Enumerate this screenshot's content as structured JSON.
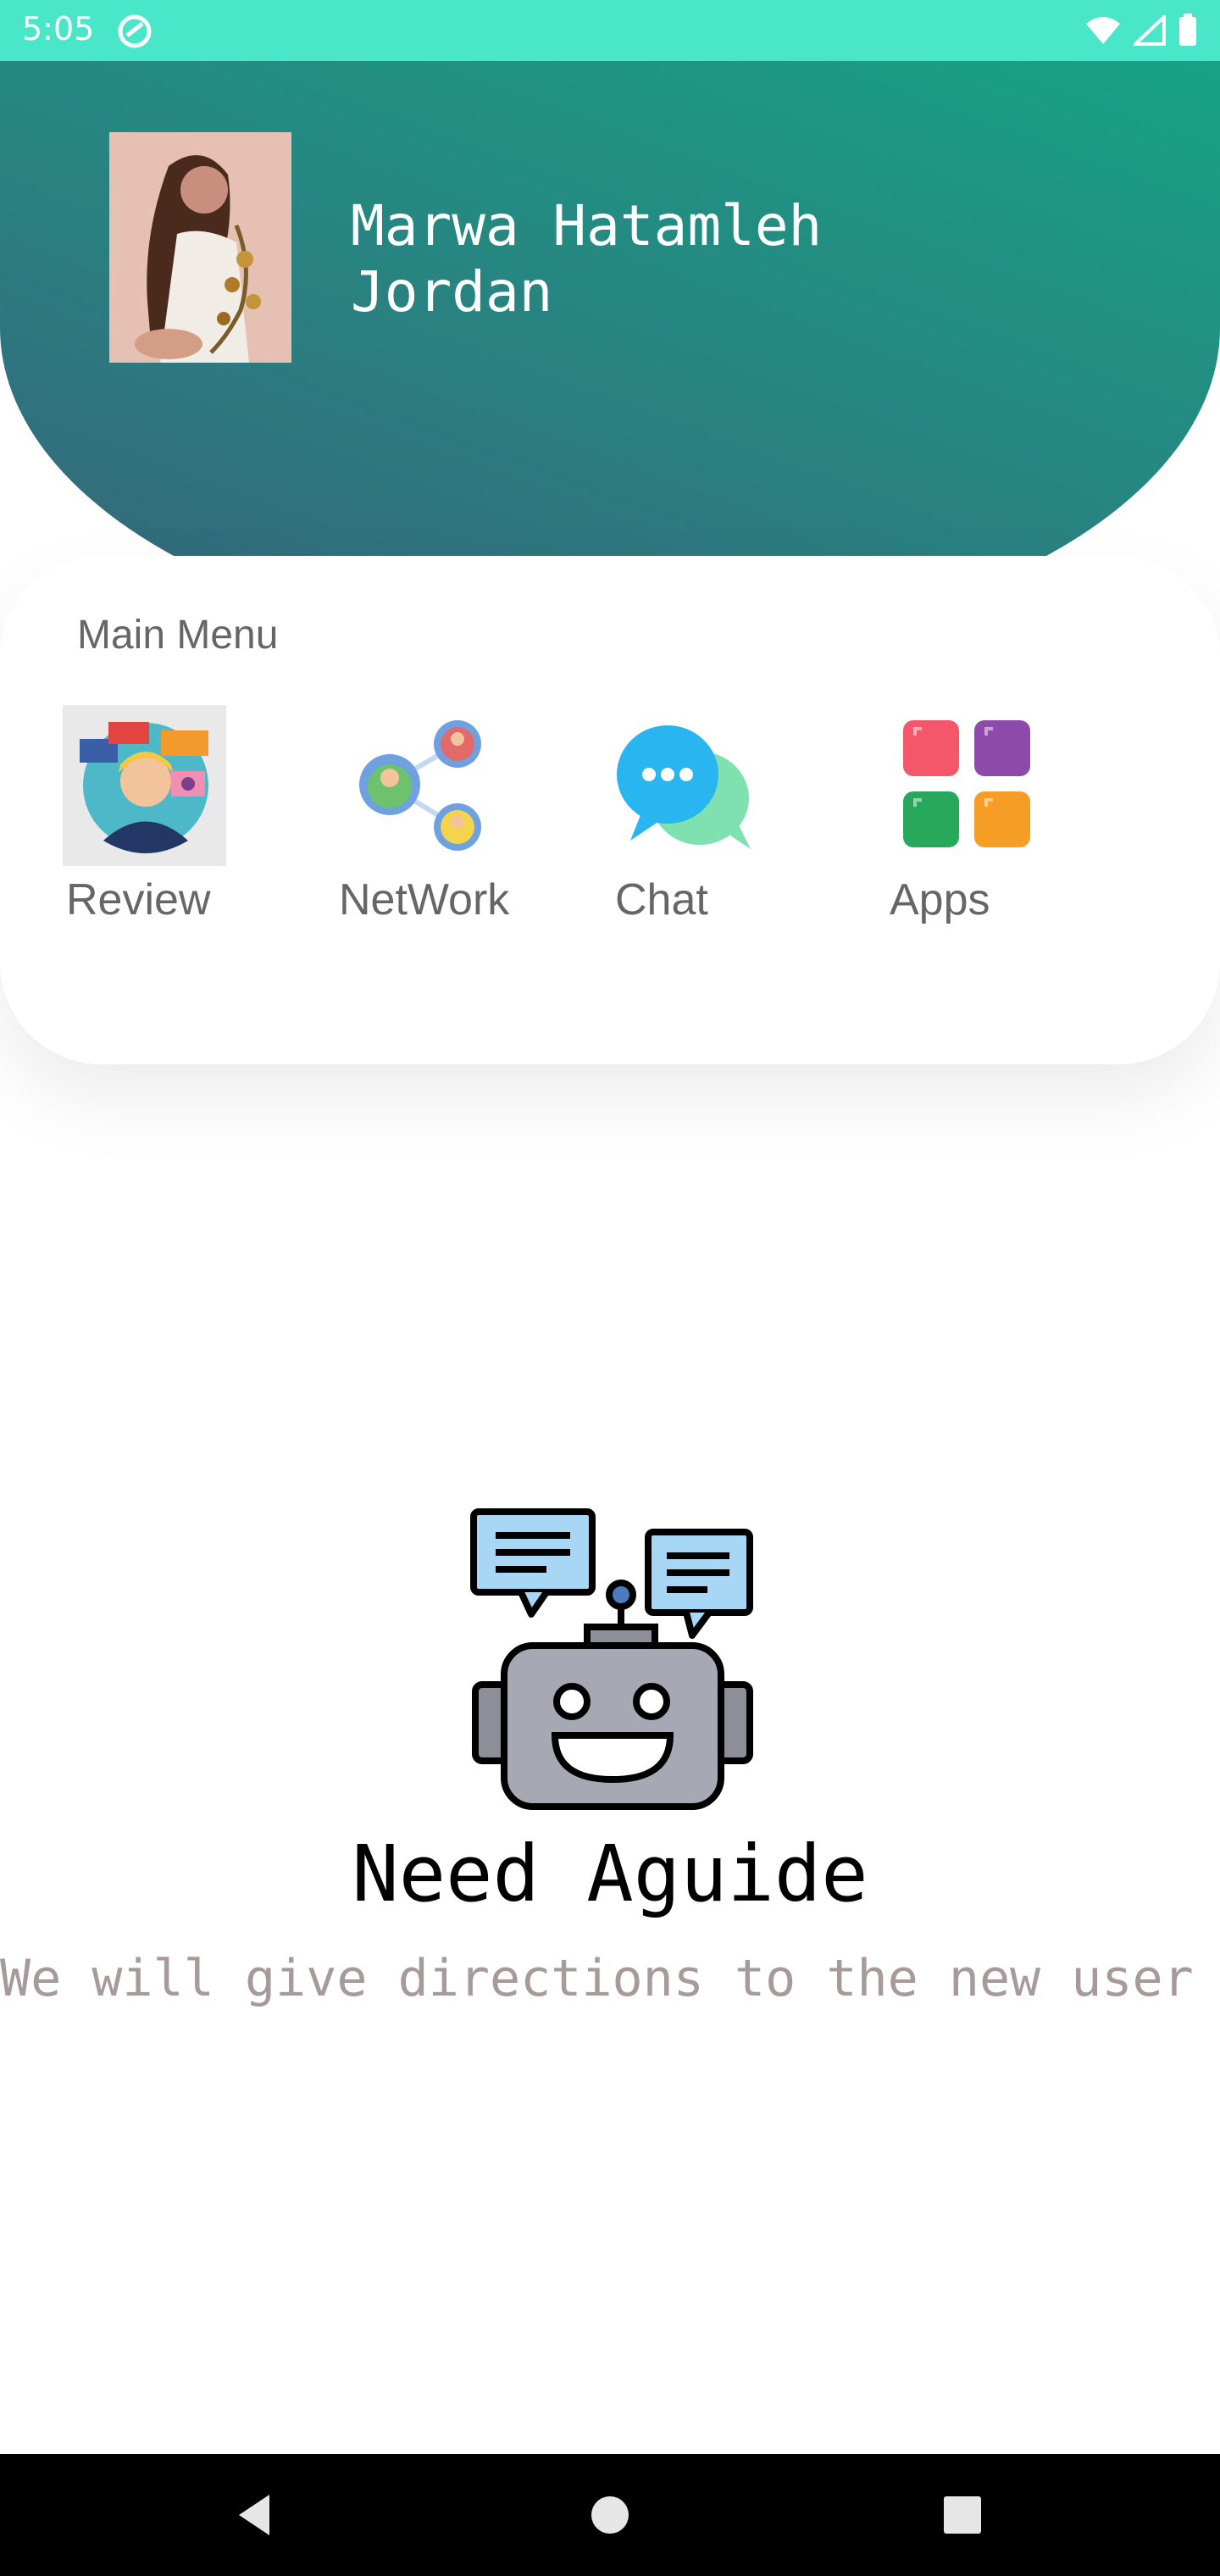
{
  "status_bar": {
    "time": "5:05",
    "icons": [
      "wifi-icon",
      "signal-icon",
      "battery-icon"
    ],
    "background": "#4ae6c9"
  },
  "profile": {
    "name": "Marwa Hatamleh",
    "country": "Jordan"
  },
  "main_menu": {
    "title": "Main Menu",
    "items": [
      {
        "label": "Review",
        "icon": "review-icon"
      },
      {
        "label": "NetWork",
        "icon": "network-icon"
      },
      {
        "label": "Chat",
        "icon": "chat-icon"
      },
      {
        "label": "Apps",
        "icon": "apps-icon"
      }
    ]
  },
  "guide": {
    "title": "Need Aguide",
    "subtitle": "We will give directions to the new user",
    "icon": "robot-icon"
  },
  "nav_bar": {
    "buttons": [
      "back-icon",
      "home-icon",
      "recents-icon"
    ]
  },
  "colors": {
    "header_gradient": [
      "#17a285",
      "#37617a"
    ],
    "status_bar": "#4ae6c9",
    "subtitle": "#a79a9a"
  }
}
